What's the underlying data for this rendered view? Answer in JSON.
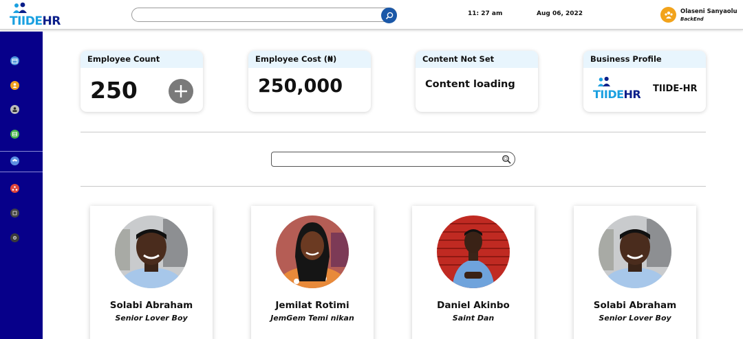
{
  "header": {
    "brand_part1": "TIIDE",
    "brand_part2": "HR",
    "search": {
      "value": "",
      "placeholder": ""
    },
    "time": "11: 27 am",
    "date": "Aug 06, 2022",
    "user": {
      "name": "Olaseni Sanyaolu",
      "role": "BackEnd"
    }
  },
  "sidebar": {
    "items": [
      {
        "icon": "calendar-icon",
        "color": "#4a90d9"
      },
      {
        "icon": "payroll-icon",
        "color": "#f0a020"
      },
      {
        "icon": "employee-icon",
        "color": "#bbbbbb"
      },
      {
        "icon": "records-icon",
        "color": "#47b34a"
      },
      {
        "icon": "team-icon",
        "color": "#5c8fe0"
      },
      {
        "icon": "org-chart-icon",
        "color": "#e0453a"
      },
      {
        "icon": "department-icon",
        "color": "#444444"
      },
      {
        "icon": "settings-icon",
        "color": "#3a3a3a"
      }
    ]
  },
  "cards": {
    "employee_count": {
      "title": "Employee Count",
      "value": "250"
    },
    "employee_cost": {
      "title": "Employee Cost (₦)",
      "value": "250,000"
    },
    "content_not_set": {
      "title": "Content Not Set",
      "value": "Content loading"
    },
    "business_profile": {
      "title": "Business Profile",
      "logo_part1": "TIIDE",
      "logo_part2": "HR",
      "name": "TIIDE-HR"
    }
  },
  "directory_search": {
    "value": "",
    "placeholder": ""
  },
  "employees": [
    {
      "name": "Solabi Abraham",
      "title": "Senior Lover Boy"
    },
    {
      "name": "Jemilat Rotimi",
      "title": "JemGem Temi nikan"
    },
    {
      "name": "Daniel Akinbo",
      "title": "Saint Dan"
    },
    {
      "name": "Solabi Abraham",
      "title": "Senior Lover Boy"
    }
  ],
  "colors": {
    "sidebar": "#07008a",
    "brand_light": "#1aa0e0",
    "brand_dark": "#0b1f8a",
    "card_header": "#e8f5fd",
    "search_button": "#1b58a8",
    "avatar": "#f2a31b"
  }
}
